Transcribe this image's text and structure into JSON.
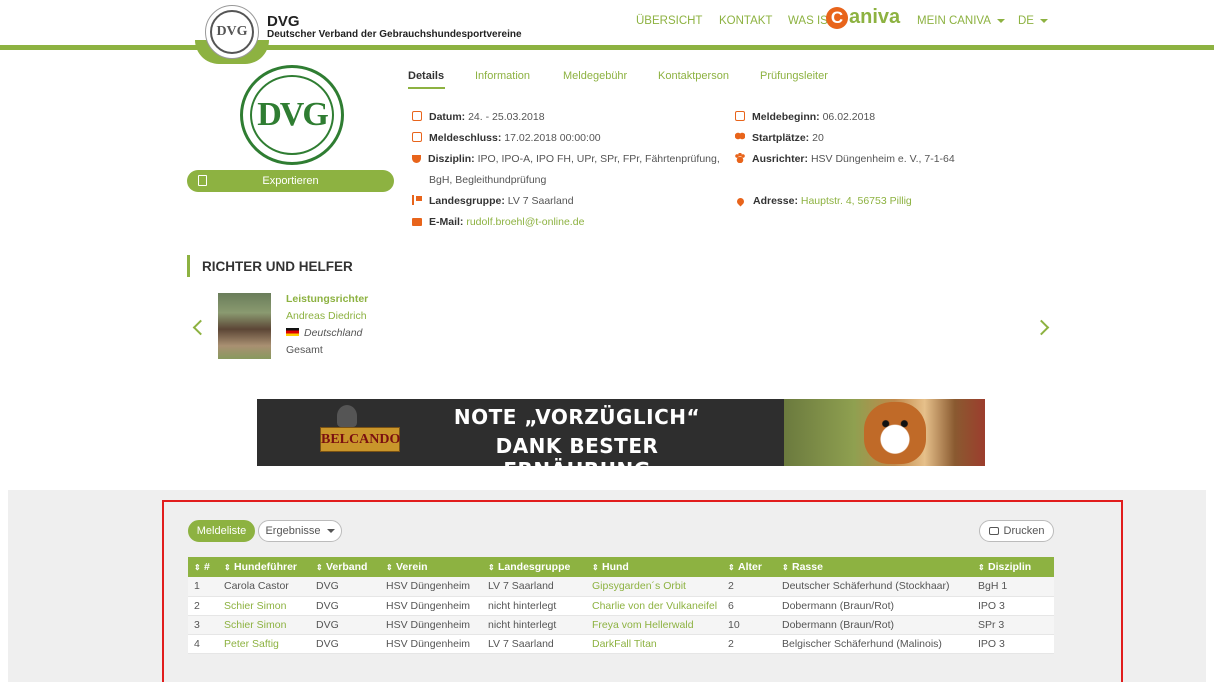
{
  "header": {
    "brand_title": "DVG",
    "brand_subtitle": "Deutscher Verband der Gebrauchshundesportvereine",
    "logo_text": "DVG",
    "nav": {
      "overview": "ÜBERSICHT",
      "contact": "KONTAKT",
      "what_is": "WAS IST",
      "caniva": "aniva",
      "my_caniva": "MEIN CANIVA",
      "language": "DE"
    }
  },
  "sidebar": {
    "logo_text": "DVG",
    "export_label": "Exportieren"
  },
  "tabs": [
    "Details",
    "Information",
    "Meldegebühr",
    "Kontaktperson",
    "Prüfungsleiter"
  ],
  "details": {
    "datum_label": "Datum:",
    "datum_value": "24. - 25.03.2018",
    "meldeschluss_label": "Meldeschluss:",
    "meldeschluss_value": "17.02.2018 00:00:00",
    "disziplin_label": "Disziplin:",
    "disziplin_value_1": "IPO, IPO-A, IPO FH, UPr, SPr, FPr, Fährtenprüfung,",
    "disziplin_value_2": "BgH, Begleithundprüfung",
    "landesgruppe_label": "Landesgruppe:",
    "landesgruppe_value": "LV 7 Saarland",
    "email_label": "E-Mail:",
    "email_value": "rudolf.broehl@t-online.de",
    "meldebeginn_label": "Meldebeginn:",
    "meldebeginn_value": "06.02.2018",
    "startplaetze_label": "Startplätze:",
    "startplaetze_value": "20",
    "ausrichter_label": "Ausrichter:",
    "ausrichter_value": "HSV Düngenheim e. V., 7-1-64",
    "adresse_label": "Adresse:",
    "adresse_value": "Hauptstr. 4, 56753 Pillig"
  },
  "judges": {
    "section_title": "RICHTER UND HELFER",
    "role": "Leistungsrichter",
    "name": "Andreas Diedrich",
    "country": "Deutschland",
    "scope": "Gesamt"
  },
  "banner": {
    "brand": "BELCANDO",
    "line1": "NOTE „VORZÜGLICH“",
    "line2": "DANK BESTER ERNÄHRUNG"
  },
  "results": {
    "tab_entries": "Meldeliste",
    "tab_results": "Ergebnisse",
    "print_label": "Drucken",
    "sort_glyph": "⇕",
    "columns": [
      "#",
      "Hundeführer",
      "Verband",
      "Verein",
      "Landesgruppe",
      "Hund",
      "Alter",
      "Rasse",
      "Disziplin"
    ],
    "rows": [
      [
        "1",
        "Carola Castor",
        "DVG",
        "HSV Düngenheim",
        "LV 7 Saarland",
        "Gipsygarden´s Orbit",
        "2",
        "Deutscher Schäferhund (Stockhaar)",
        "BgH 1"
      ],
      [
        "2",
        "Schier Simon",
        "DVG",
        "HSV Düngenheim",
        "nicht hinterlegt",
        "Charlie von der Vulkaneifel",
        "6",
        "Dobermann (Braun/Rot)",
        "IPO 3"
      ],
      [
        "3",
        "Schier Simon",
        "DVG",
        "HSV Düngenheim",
        "nicht hinterlegt",
        "Freya vom Hellerwald",
        "10",
        "Dobermann (Braun/Rot)",
        "SPr 3"
      ],
      [
        "4",
        "Peter Saftig",
        "DVG",
        "HSV Düngenheim",
        "LV 7 Saarland",
        "DarkFall Titan",
        "2",
        "Belgischer Schäferhund (Malinois)",
        "IPO 3"
      ]
    ]
  }
}
